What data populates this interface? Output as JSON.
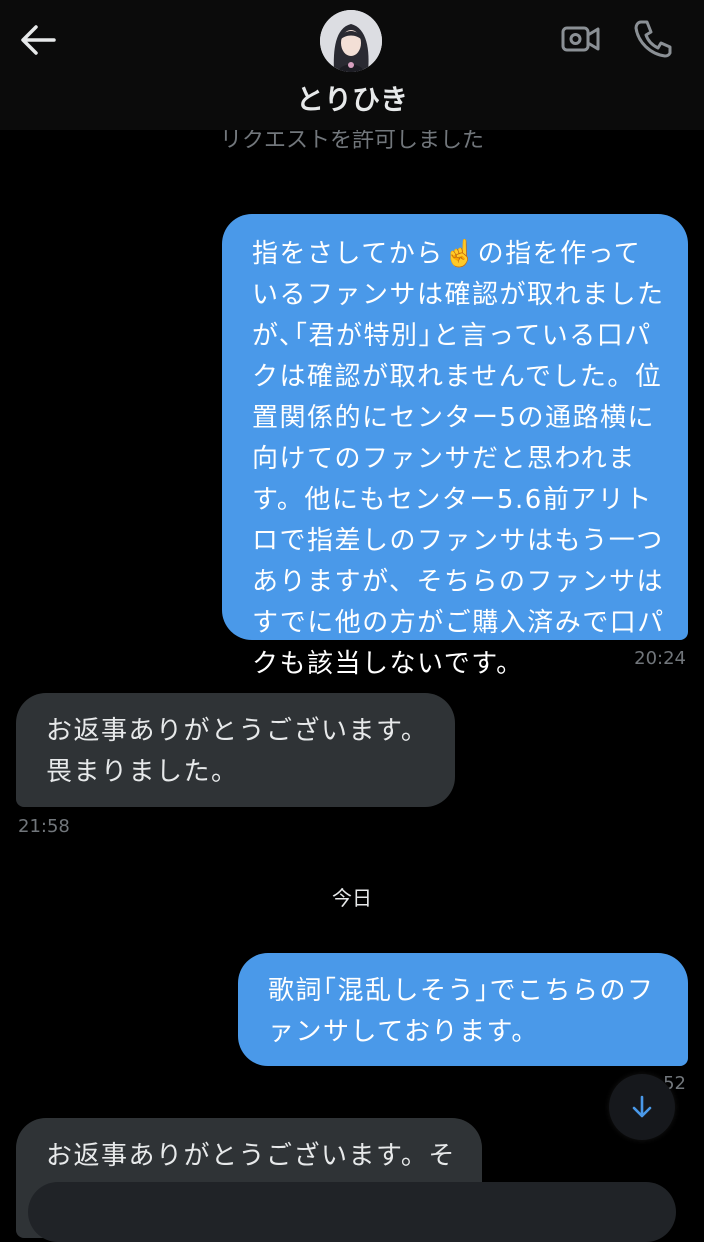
{
  "header": {
    "title": "とりひき",
    "back_icon": "arrow-left-icon",
    "video_icon": "video-call-icon",
    "phone_icon": "phone-icon"
  },
  "system_notice": "リクエストを許可しました",
  "messages": [
    {
      "direction": "outgoing",
      "text_before_emoji": "指をさしてから",
      "emoji": "☝️",
      "text_after_emoji": "の指を作っているファンサは確認が取れましたが､｢君が特別｣と言っている口パクは確認が取れませんでした。位置関係的にセンター5の通路横に向けてのファンサだと思われます。他にもセンター5.6前アリトロで指差しのファンサはもう一つありますが、そちらのファンサはすでに他の方がご購入済みで口パクも該当しないです。",
      "time": "20:24"
    },
    {
      "direction": "incoming",
      "text": "お返事ありがとうございます。畏まりました。",
      "time": "21:58"
    },
    {
      "direction": "outgoing",
      "text": "歌詞｢混乱しそう｣でこちらのファンサしております。",
      "time": "52"
    },
    {
      "direction": "incoming",
      "text": "お返事ありがとうございます。そ"
    }
  ],
  "date_separator": "今日",
  "scroll_button_icon": "arrow-down-icon",
  "colors": {
    "background": "#000000",
    "outgoing_bubble": "#4a99e9",
    "incoming_bubble": "#2f3336",
    "muted_text": "#71767b"
  }
}
